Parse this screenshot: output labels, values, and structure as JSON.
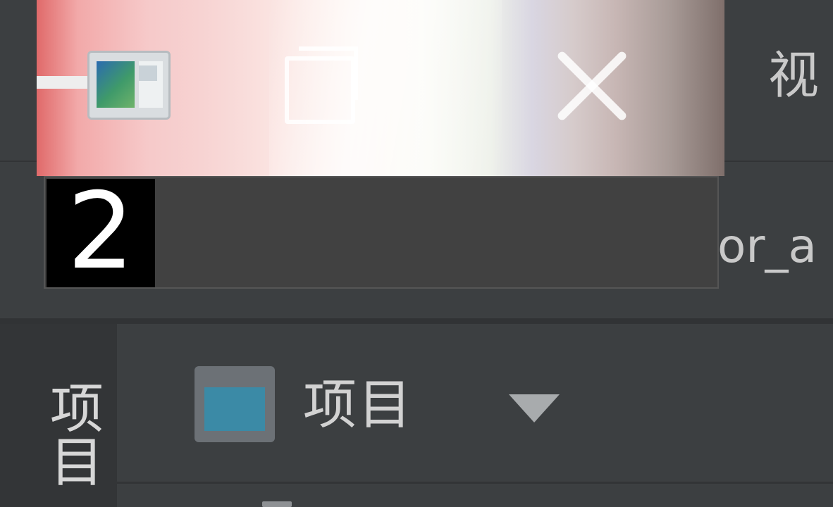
{
  "menu": {
    "fragment": "视"
  },
  "toolbar": {
    "path_fragment": "or_a"
  },
  "taskbar_preview": {
    "window_number": "2",
    "minimize_icon": "minimize-icon",
    "restore_icon": "restore-icon",
    "close_icon": "close-icon"
  },
  "tool_strip": {
    "label": "项目"
  },
  "project_panel": {
    "title": "项目",
    "icon": "project-view-icon",
    "dropdown_icon": "dropdown-arrow-icon"
  },
  "colors": {
    "ide_background": "#3c3f41",
    "tool_strip": "#333537",
    "project_icon_accent": "#3b8aa6",
    "caption_bar": "#414141"
  }
}
